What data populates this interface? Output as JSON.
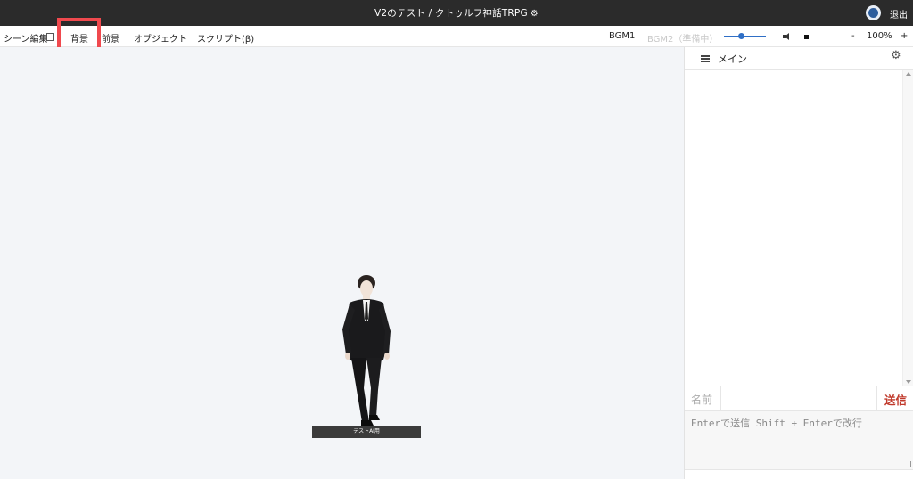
{
  "titlebar": {
    "title": "V2のテスト / クトゥルフ神話TRPG",
    "settings_icon": "gear-icon",
    "exit_label": "退出"
  },
  "toolbar": {
    "scene_edit_label": "シーン編集",
    "scene_edit_checked": false,
    "background_tab": "背景",
    "foreground_tab": "前景",
    "object_tab": "オブジェクト",
    "script_tab": "スクリプト(β)",
    "bgm1_label": "BGM1",
    "bgm2_label": "BGM2（準備中）",
    "volume_level": 0.4,
    "zoom_minus": "-",
    "zoom_level": "100%",
    "zoom_plus": "+",
    "highlight_color": "#f0494e"
  },
  "stage": {
    "token_label": "テストAI用"
  },
  "chat": {
    "tab_label": "メイン",
    "name_label": "名前",
    "name_value": "",
    "send_label": "送信",
    "message_placeholder": "Enterで送信 Shift + Enterで改行",
    "accent_color": "#c0392b"
  }
}
